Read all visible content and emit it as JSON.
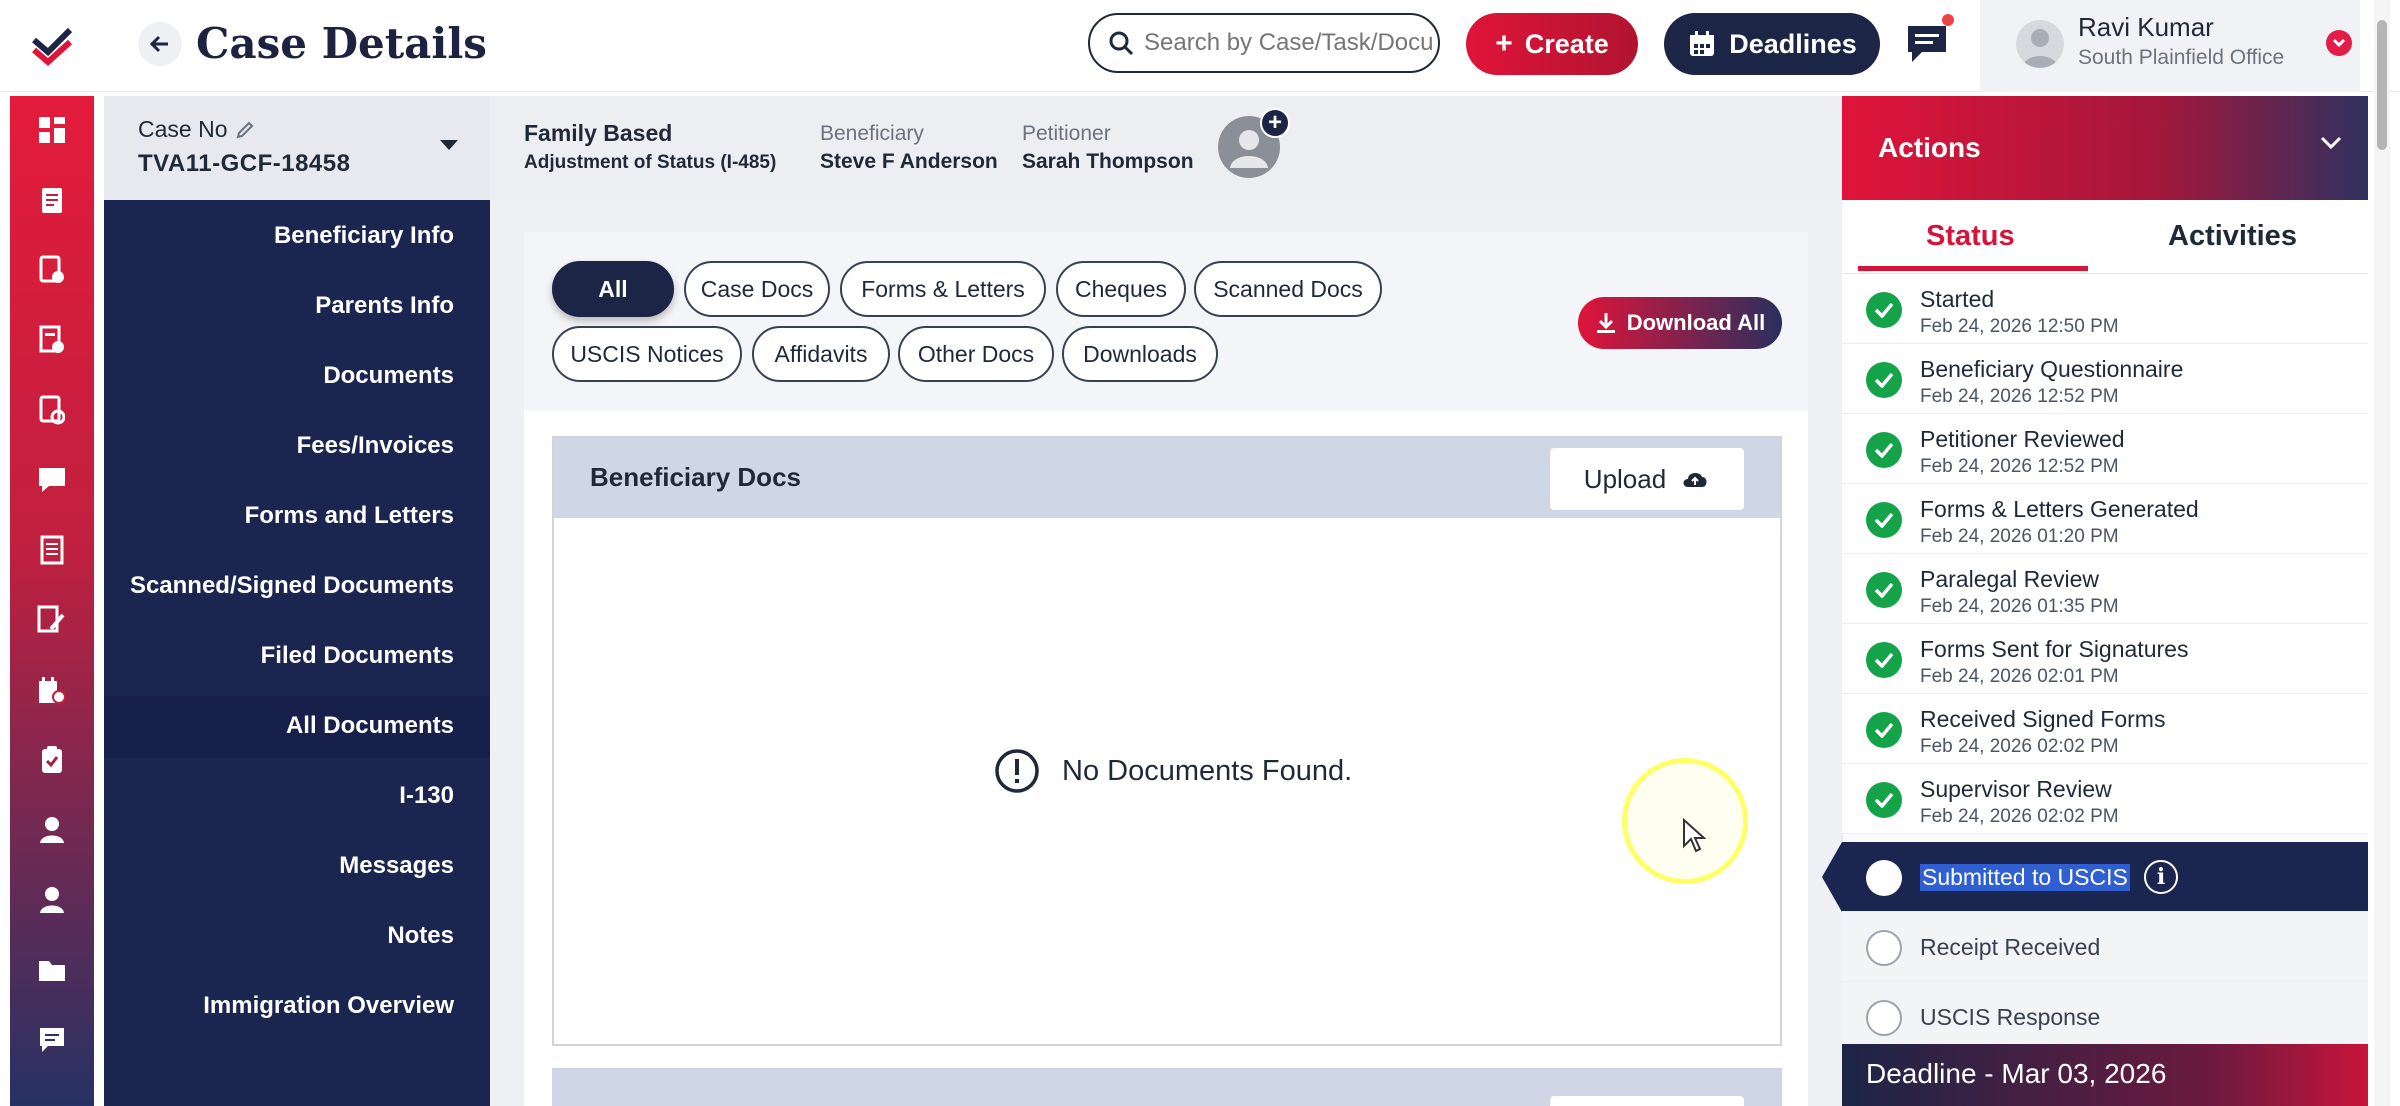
{
  "header": {
    "title": "Case Details",
    "search_placeholder": "Search by Case/Task/Docu",
    "create_label": "Create",
    "deadlines_label": "Deadlines",
    "user": {
      "name": "Ravi Kumar",
      "office": "South Plainfield Office"
    }
  },
  "case": {
    "case_no_label": "Case No",
    "case_no": "TVA11-GCF-18458",
    "type_title": "Family Based",
    "type_sub": "Adjustment of Status (I-485)",
    "beneficiary_label": "Beneficiary",
    "beneficiary": "Steve F Anderson",
    "petitioner_label": "Petitioner",
    "petitioner": "Sarah Thompson"
  },
  "left_nav": {
    "items": [
      "Beneficiary Info",
      "Parents Info",
      "Documents",
      "Fees/Invoices",
      "Forms and Letters",
      "Scanned/Signed Documents",
      "Filed Documents",
      "All Documents",
      "I-130",
      "Messages",
      "Notes",
      "Immigration Overview"
    ],
    "active": "All Documents"
  },
  "filters": {
    "chips": [
      "All",
      "Case Docs",
      "Forms & Letters",
      "Cheques",
      "Scanned Docs",
      "USCIS Notices",
      "Affidavits",
      "Other Docs",
      "Downloads"
    ],
    "active": "All",
    "download_all_label": "Download All"
  },
  "beneficiary_docs": {
    "title": "Beneficiary Docs",
    "upload_label": "Upload",
    "empty_message": "No Documents Found."
  },
  "actions_panel": {
    "title": "Actions",
    "tabs": [
      "Status",
      "Activities"
    ],
    "active_tab": "Status",
    "statuses": [
      {
        "label": "Started",
        "date": "Feb 24, 2026 12:50 PM",
        "state": "done"
      },
      {
        "label": "Beneficiary Questionnaire",
        "date": "Feb 24, 2026 12:52 PM",
        "state": "done"
      },
      {
        "label": "Petitioner Reviewed",
        "date": "Feb 24, 2026 12:52 PM",
        "state": "done"
      },
      {
        "label": "Forms & Letters Generated",
        "date": "Feb 24, 2026 01:20 PM",
        "state": "done"
      },
      {
        "label": "Paralegal Review",
        "date": "Feb 24, 2026 01:35 PM",
        "state": "done"
      },
      {
        "label": "Forms Sent for Signatures",
        "date": "Feb 24, 2026 02:01 PM",
        "state": "done"
      },
      {
        "label": "Received Signed Forms",
        "date": "Feb 24, 2026 02:02 PM",
        "state": "done"
      },
      {
        "label": "Supervisor Review",
        "date": "Feb 24, 2026 02:02 PM",
        "state": "done"
      },
      {
        "label": "Submitted to USCIS",
        "date": "",
        "state": "current"
      },
      {
        "label": "Receipt Received",
        "date": "",
        "state": "pending"
      },
      {
        "label": "USCIS Response",
        "date": "",
        "state": "pending"
      }
    ],
    "deadline": "Deadline - Mar 03, 2026"
  },
  "colors": {
    "brand_red": "#e0143a",
    "navy": "#1a2550",
    "success_green": "#15a34a"
  },
  "icons": {
    "rail": [
      "dashboard-icon",
      "cases-icon",
      "case-doc-icon",
      "forms-icon",
      "invoice-icon",
      "message-icon",
      "report-icon",
      "edit-doc-icon",
      "calendar-doc-icon",
      "clipboard-icon",
      "user-icon",
      "contacts-icon",
      "folder-icon",
      "notes-icon"
    ]
  }
}
